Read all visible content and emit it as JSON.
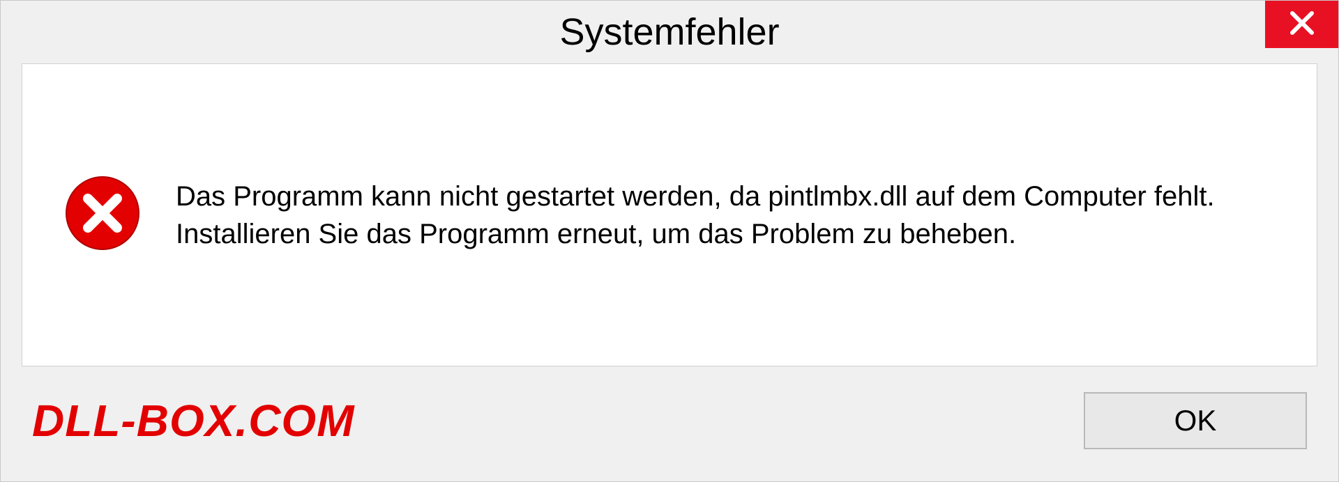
{
  "dialog": {
    "title": "Systemfehler",
    "message": "Das Programm kann nicht gestartet werden, da pintlmbx.dll auf dem Computer fehlt. Installieren Sie das Programm erneut, um das Problem zu beheben.",
    "ok_label": "OK"
  },
  "watermark": "DLL-BOX.COM"
}
